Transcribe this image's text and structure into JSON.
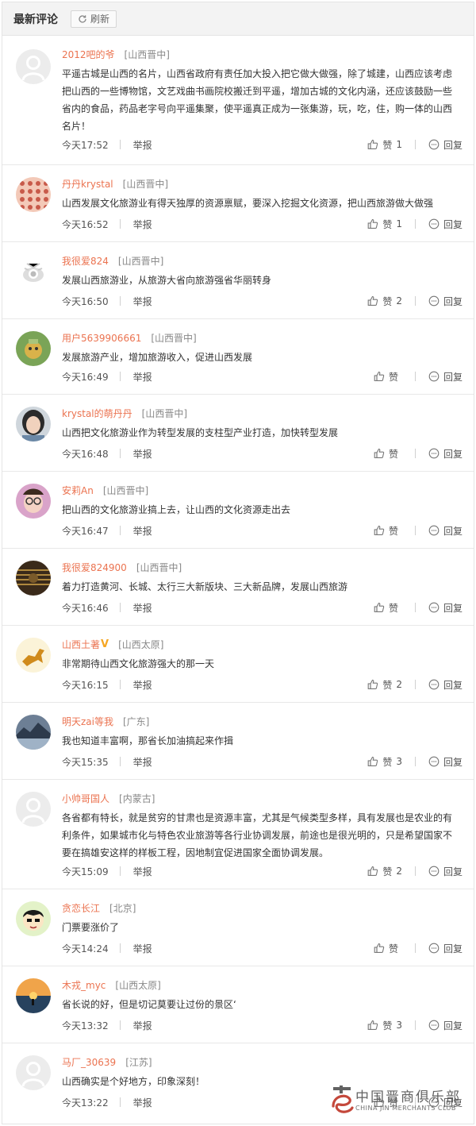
{
  "header": {
    "title": "最新评论",
    "refresh_label": "刷新"
  },
  "report_label": "举报",
  "like_label": "赞",
  "reply_label": "回复",
  "comments": [
    {
      "username": "2012吧的爷",
      "verified": false,
      "location": "[山西晋中]",
      "text": "平遥古城是山西的名片，山西省政府有责任加大投入把它做大做强，除了城建，山西应该考虑把山西的一些博物馆，文艺戏曲书画院校搬迁到平遥，增加古城的文化内涵，还应该鼓励一些省内的食品，药品老字号向平遥集聚，使平遥真正成为一张集游，玩，吃，住，购一体的山西名片！",
      "time": "今天17:52",
      "likes": "1",
      "avatar": "default-avatar"
    },
    {
      "username": "丹丹krystal",
      "verified": false,
      "location": "[山西晋中]",
      "text": "山西发展文化旅游业有得天独厚的资源禀赋，要深入挖掘文化资源，把山西旅游做大做强",
      "time": "今天16:52",
      "likes": "1",
      "avatar": "pattern-avatar"
    },
    {
      "username": "我很爱824",
      "verified": false,
      "location": "[山西晋中]",
      "text": "发展山西旅游业，从旅游大省向旅游强省华丽转身",
      "time": "今天16:50",
      "likes": "2",
      "avatar": "weibo-eye-avatar"
    },
    {
      "username": "用户5639906661",
      "verified": false,
      "location": "[山西晋中]",
      "text": "发展旅游产业，增加旅游收入，促进山西发展",
      "time": "今天16:49",
      "likes": "",
      "avatar": "green-avatar"
    },
    {
      "username": "krystal的萌丹丹",
      "verified": false,
      "location": "[山西晋中]",
      "text": "山西把文化旅游业作为转型发展的支柱型产业打造，加快转型发展",
      "time": "今天16:48",
      "likes": "",
      "avatar": "girl-avatar"
    },
    {
      "username": "安莉An",
      "verified": false,
      "location": "[山西晋中]",
      "text": "把山西的文化旅游业搞上去，让山西的文化资源走出去",
      "time": "今天16:47",
      "likes": "",
      "avatar": "glasses-avatar"
    },
    {
      "username": "我很爱824900",
      "verified": false,
      "location": "[山西晋中]",
      "text": "着力打造黄河、长城、太行三大新版块、三大新品牌，发展山西旅游",
      "time": "今天16:46",
      "likes": "",
      "avatar": "dark-avatar"
    },
    {
      "username": "山西土著",
      "verified": true,
      "verified_mark": "V",
      "location": "[山西太原]",
      "text": "非常期待山西文化旅游强大的那一天",
      "time": "今天16:15",
      "likes": "2",
      "avatar": "horse-avatar"
    },
    {
      "username": "明天zai等我",
      "verified": false,
      "location": "[广东]",
      "text": "我也知道丰富啊，那省长加油搞起来作揖",
      "time": "今天15:35",
      "likes": "3",
      "avatar": "lake-avatar"
    },
    {
      "username": "小帅哥国人",
      "verified": false,
      "location": "[内蒙古]",
      "text": "各省都有特长，就是贫穷的甘肃也是资源丰富，尤其是气候类型多样，具有发展也是农业的有利条件，如果城市化与特色农业旅游等各行业协调发展，前途也是很光明的，只是希望国家不要在搞雄安这样的样板工程，因地制宜促进国家全面协调发展。",
      "time": "今天15:09",
      "likes": "2",
      "avatar": "default-avatar"
    },
    {
      "username": "贪恋长江",
      "verified": false,
      "location": "[北京]",
      "text": "门票要涨价了",
      "time": "今天14:24",
      "likes": "",
      "avatar": "cartoon-avatar"
    },
    {
      "username": "木戎_myc",
      "verified": false,
      "location": "[山西太原]",
      "text": "省长说的好，但是切记莫要让过份的景区‘",
      "time": "今天13:32",
      "likes": "3",
      "avatar": "sunset-avatar"
    },
    {
      "username": "马厂_30639",
      "verified": false,
      "location": "[江苏]",
      "text": "山西确实是个好地方，印象深刻！",
      "time": "今天13:22",
      "likes": "",
      "avatar": "default-avatar"
    }
  ],
  "watermark": {
    "cn": "中国晋商俱乐部",
    "en": "CHINA JIN MERCHANTS CLUB"
  }
}
